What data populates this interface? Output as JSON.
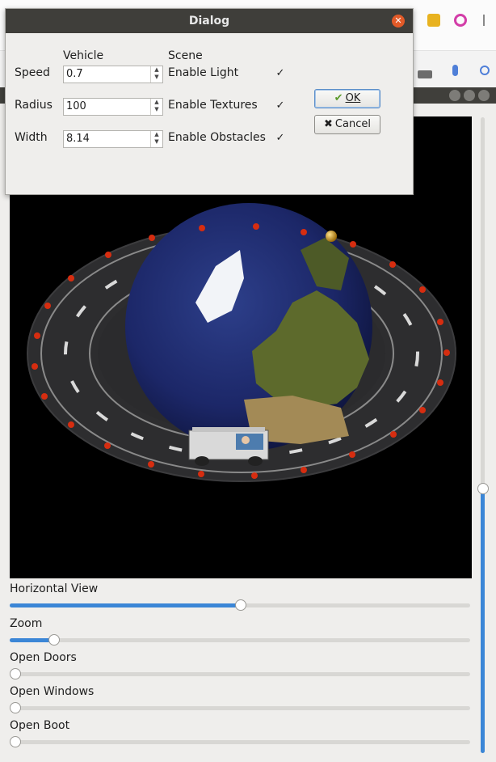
{
  "dialog": {
    "title": "Dialog",
    "vehicle_header": "Vehicle",
    "scene_header": "Scene",
    "fields": [
      {
        "label": "Speed",
        "value": "0.7"
      },
      {
        "label": "Radius",
        "value": "100"
      },
      {
        "label": "Width",
        "value": "8.14"
      }
    ],
    "options": [
      {
        "label": "Enable Light",
        "checked": true
      },
      {
        "label": "Enable Textures",
        "checked": true
      },
      {
        "label": "Enable Obstacles",
        "checked": true
      }
    ],
    "ok_label": "OK",
    "cancel_label": "Cancel"
  },
  "sliders": [
    {
      "label": "Horizontal View",
      "value": 0.5
    },
    {
      "label": "Zoom",
      "value": 0.095
    },
    {
      "label": "Open Doors",
      "value": 0
    },
    {
      "label": "Open Windows",
      "value": 0
    },
    {
      "label": "Open Boot",
      "value": 0
    }
  ],
  "vertical_slider": {
    "value": 0.58
  },
  "colors": {
    "accent": "#3b86d6",
    "titlebar": "#3f3e3a",
    "close": "#e25a28"
  }
}
